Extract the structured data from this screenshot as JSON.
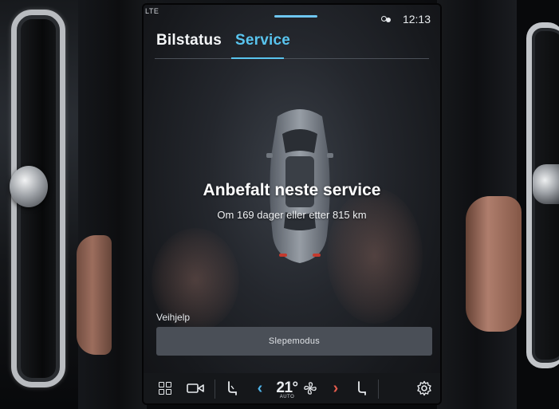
{
  "status_bar": {
    "signal": "LTE",
    "time": "12:13"
  },
  "tabs": [
    {
      "label": "Bilstatus"
    },
    {
      "label": "Service"
    }
  ],
  "service": {
    "title": "Anbefalt neste service",
    "subtitle": "Om 169 dager eller etter 815 km"
  },
  "roadside": {
    "label": "Veihjelp",
    "tow_button": "Slepemodus"
  },
  "climate": {
    "temperature": "21°",
    "mode": "AUTO"
  },
  "colors": {
    "accent": "#59c4ee",
    "screen_bg": "#24272d",
    "button_bg": "#4a4f57",
    "chevron_left": "#4fb3e8",
    "chevron_right": "#e45c4d"
  },
  "icons": {
    "home": "grid-icon",
    "camera": "camera-icon",
    "driver_seat": "seat-icon",
    "fan": "fan-icon",
    "passenger_seat": "seat-heat-icon",
    "settings": "gear-icon",
    "profile": "profile-icon"
  }
}
